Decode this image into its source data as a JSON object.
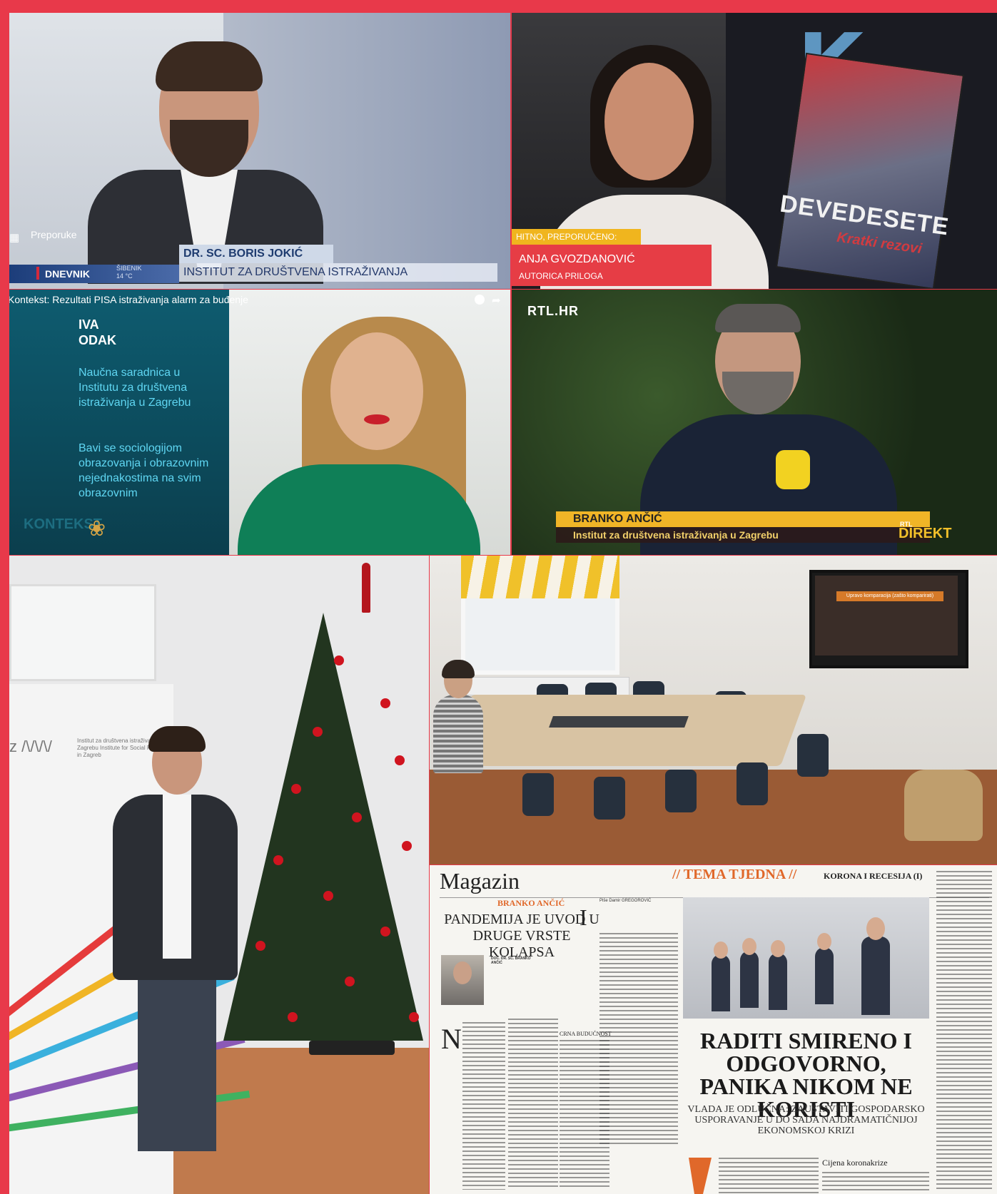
{
  "tile1": {
    "preporuke_label": "Preporuke",
    "guest_name": "DR. SC. BORIS JOKIĆ",
    "guest_affiliation": "INSTITUT ZA DRUŠTVENA ISTRAŽIVANJA",
    "show": "DNEVNIK",
    "weather": "ŠIBENIK\n14 °C"
  },
  "tile2": {
    "tag": "HITNO, PREPORUČENO: KNJIGA",
    "guest_name": "ANJA GVOZDANOVIĆ",
    "guest_role": "AUTORICA PRILOGA",
    "book_title": "DEVEDESETE",
    "book_subtitle": "Kratki rezovi"
  },
  "tile3": {
    "video_title": "Kontekst: Rezultati PISA istraživanja alarm za buđenje",
    "name_line1": "IVA",
    "name_line2": "ODAK",
    "description": "Naučna saradnica u Institutu za društvena istraživanja u Zagrebu",
    "description2": "Bavi se sociologijom obrazovanja i obrazovnim nejednakostima na svim obrazovnim",
    "show": "KONTEKST"
  },
  "tile4": {
    "channel": "RTL.HR",
    "guest_name": "BRANKO ANČIĆ",
    "guest_affiliation": "Institut za društvena istraživanja u Zagrebu",
    "show_small": "RTL",
    "show": "DIREKT"
  },
  "tile5": {
    "banner_logo": "z /\\/\\/\\/",
    "banner_text": "Institut za društvena istraživanja u Zagrebu Institute for Social Research in Zagreb"
  },
  "tile6": {
    "tv_slide_title": "Upravo komparacija (zašto komparirati)"
  },
  "tile7": {
    "section": "Magazin",
    "theme": "// TEMA TJEDNA //",
    "series": "KORONA I RECESIJA (I)",
    "author": "BRANKO ANČIĆ",
    "left_headline": "PANDEMIJA JE UVOD U DRUGE VRSTE KOLAPSA",
    "byline": "Piše Damir GREGOROVIĆ",
    "portrait_caption": "DOC. DR. SC. BRANKO ANČIĆ",
    "crna": "CRNA BUDUĆNOST",
    "big_N": "N",
    "big_I": "I",
    "headline": "RADITI SMIRENO I ODGOVORNO, PANIKA NIKOM NE KORISTI",
    "subhead": "VLADA JE ODLUČNA: ZAUSTAVITI GOSPODARSKO USPORAVANJE U DO SADA NAJDRAMATIČNIJOJ EKONOMSKOJ KRIZI",
    "cijena": "Cijena koronakrize"
  },
  "colors": {
    "frame": "#e8394a",
    "accent_orange": "#e0682a",
    "rtl_yellow": "#f0b527"
  }
}
